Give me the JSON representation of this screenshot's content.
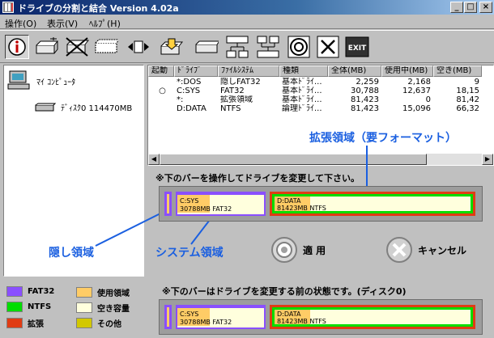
{
  "window": {
    "title": "ドライブの分割と結合 Version 4.02a",
    "controls": {
      "minimize": "_",
      "maximize": "□",
      "close": "×"
    }
  },
  "menu": [
    "操作(O)",
    "表示(V)",
    "ﾍﾙﾌﾟ(H)"
  ],
  "toolbar": [
    "info-icon",
    "drive-new-icon",
    "drive-delete-icon",
    "drive-dashed-icon",
    "resize-arrows-icon",
    "drive-move-icon",
    "drive-flat-icon",
    "split-icon",
    "merge-icon",
    "apply-target-icon",
    "cancel-x-icon",
    "exit-icon"
  ],
  "toolbar_exit_label": "EXIT",
  "tree": {
    "root": "ﾏｲ ｺﾝﾋﾟｭｰﾀ",
    "disk": "ﾃﾞｨｽｸ0 114470MB"
  },
  "list": {
    "columns": [
      "起動",
      "ﾄﾞﾗｲﾌﾞ",
      "ﾌｧｲﾙｼｽﾃﾑ",
      "種類",
      "全体(MB)",
      "使用中(MB)",
      "空き(MB)"
    ],
    "rows": [
      [
        "",
        "*:DOS",
        "隠しFAT32",
        "基本ﾄﾞﾗｲ...",
        "2,259",
        "2,168",
        "9"
      ],
      [
        "○",
        "C:SYS",
        "FAT32",
        "基本ﾄﾞﾗｲ...",
        "30,788",
        "12,637",
        "18,15"
      ],
      [
        "",
        "*:",
        "拡張領域",
        "基本ﾄﾞﾗｲ...",
        "81,423",
        "0",
        "81,42"
      ],
      [
        "",
        "D:DATA",
        "NTFS",
        "論理ﾄﾞﾗｲ...",
        "81,423",
        "15,096",
        "66,32"
      ]
    ]
  },
  "operation": {
    "instruction": "※下のバーを操作してドライブを変更して下さい。",
    "c_name": "C:SYS",
    "c_info": "30788MB FAT32",
    "d_name": "D:DATA",
    "d_info": "81423MB NTFS",
    "apply_label": "適 用",
    "cancel_label": "キャンセル"
  },
  "annotations": {
    "extended": "拡張領域（要フォーマット）",
    "hidden": "隠し領域",
    "system": "システム領域"
  },
  "legend": [
    {
      "label": "FAT32",
      "color": "#8a4fff"
    },
    {
      "label": "使用領域",
      "color": "#ffcc66"
    },
    {
      "label": "NTFS",
      "color": "#00dd00"
    },
    {
      "label": "空き容量",
      "color": "#ffffdd"
    },
    {
      "label": "拡張",
      "color": "#e03c14"
    },
    {
      "label": "その他",
      "color": "#d2c800"
    }
  ],
  "before": {
    "instruction": "※下のバーはドライブを変更する前の状態です。(ディスク0)",
    "c_name": "C:SYS",
    "c_info": "30788MB FAT32",
    "d_name": "D:DATA",
    "d_info": "81423MB NTFS"
  }
}
